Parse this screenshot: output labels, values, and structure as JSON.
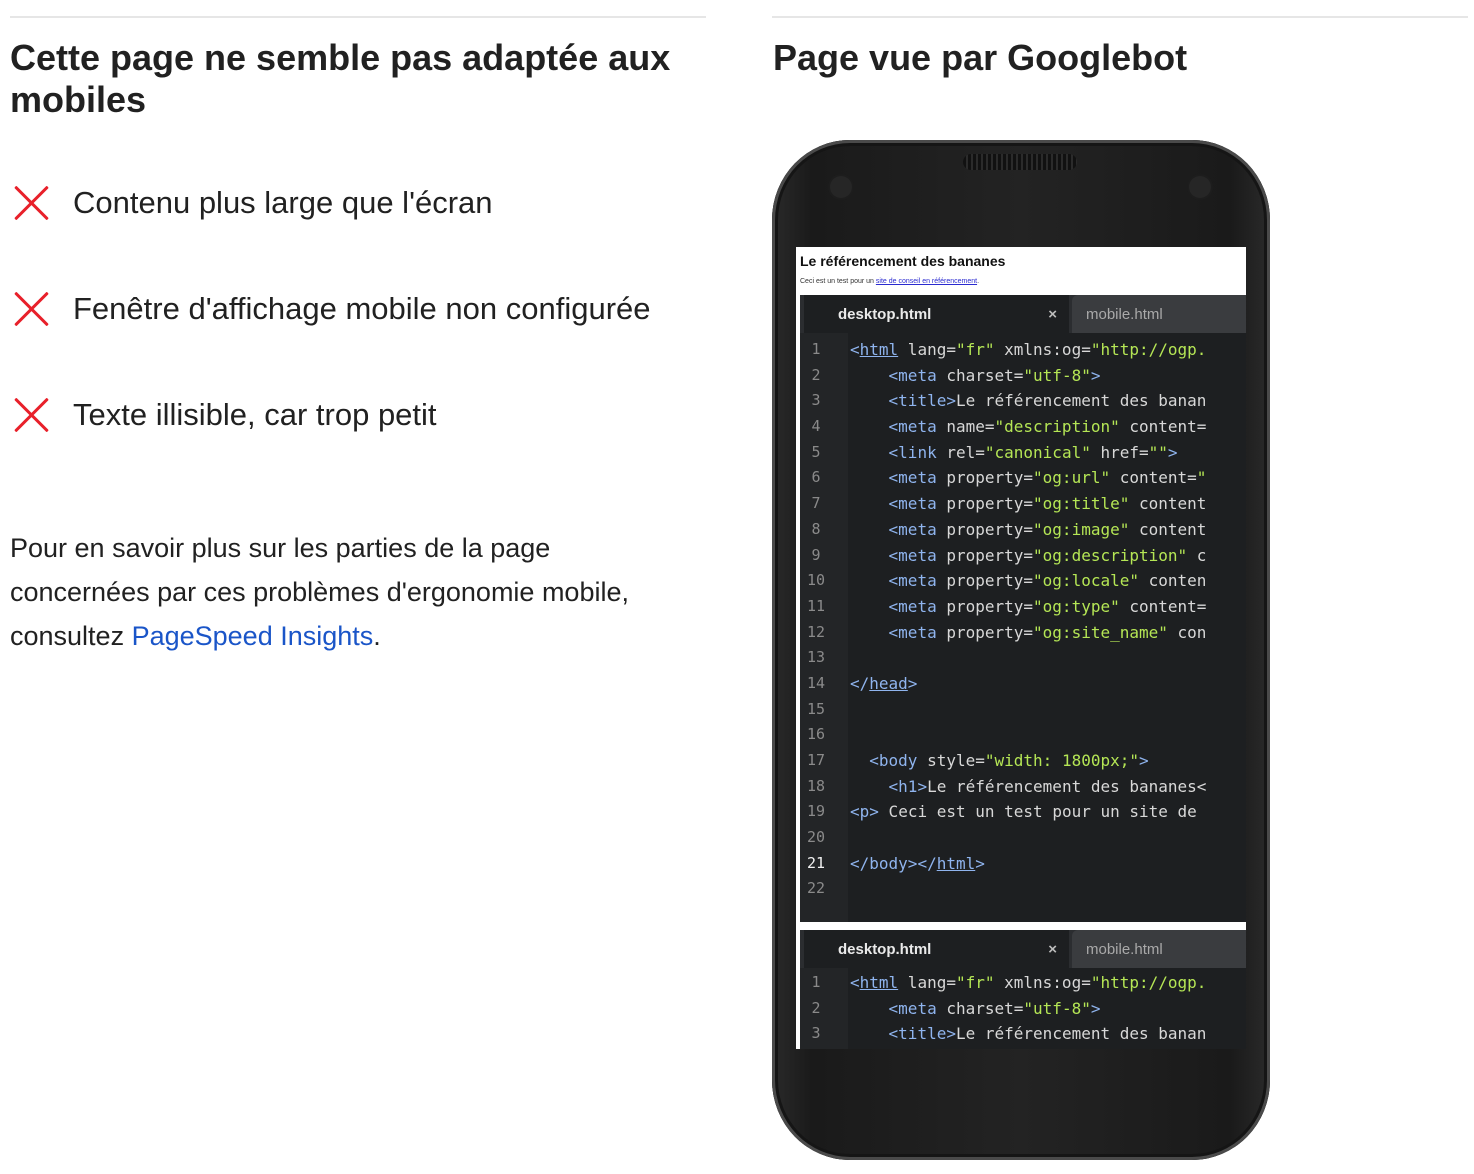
{
  "left": {
    "title": "Cette page ne semble pas adaptée aux mobiles",
    "title_line1": "Cette page ne semble pas adaptée aux",
    "title_line2": "mobiles",
    "issues": [
      {
        "icon": "x-icon",
        "label": "Contenu plus large que l'écran"
      },
      {
        "icon": "x-icon",
        "label": "Fenêtre d'affichage mobile non configurée"
      },
      {
        "icon": "x-icon",
        "label": "Texte illisible, car trop petit"
      }
    ],
    "info": {
      "line1": "Pour en savoir plus sur les parties de la page",
      "line2": "concernées par ces problèmes d'ergonomie mobile,",
      "line3_prefix": "consultez ",
      "link": "PageSpeed Insights",
      "line3_suffix": "."
    }
  },
  "right": {
    "title": "Page vue par Googlebot",
    "phone": {
      "page_title": "Le référencement des bananes",
      "page_text_prefix": "Ceci est un test pour un ",
      "page_link": "site de conseil en référencement",
      "page_text_suffix": ".",
      "tabs": [
        {
          "label": "desktop.html",
          "active": true,
          "close": "×"
        },
        {
          "label": "mobile.html",
          "active": false
        }
      ],
      "current_line": 21,
      "code_lines_top": [
        "<html lang=\"fr\" xmlns:og=\"http://ogp.",
        "    <meta charset=\"utf-8\">",
        "    <title>Le référencement des banan",
        "    <meta name=\"description\" content=",
        "    <link rel=\"canonical\" href=\"\">",
        "    <meta property=\"og:url\" content=\"",
        "    <meta property=\"og:title\" content",
        "    <meta property=\"og:image\" content",
        "    <meta property=\"og:description\" c",
        "    <meta property=\"og:locale\" conten",
        "    <meta property=\"og:type\" content=",
        "    <meta property=\"og:site_name\" con",
        "",
        "</head>",
        "",
        "",
        "  <body style=\"width: 1800px;\">",
        "    <h1>Le référencement des bananes<",
        "<p> Ceci est un test pour un site de",
        "",
        "</body></html>",
        ""
      ],
      "code_lines_bottom": [
        "<html lang=\"fr\" xmlns:og=\"http://ogp.",
        "    <meta charset=\"utf-8\">",
        "    <title>Le référencement des banan"
      ]
    }
  }
}
